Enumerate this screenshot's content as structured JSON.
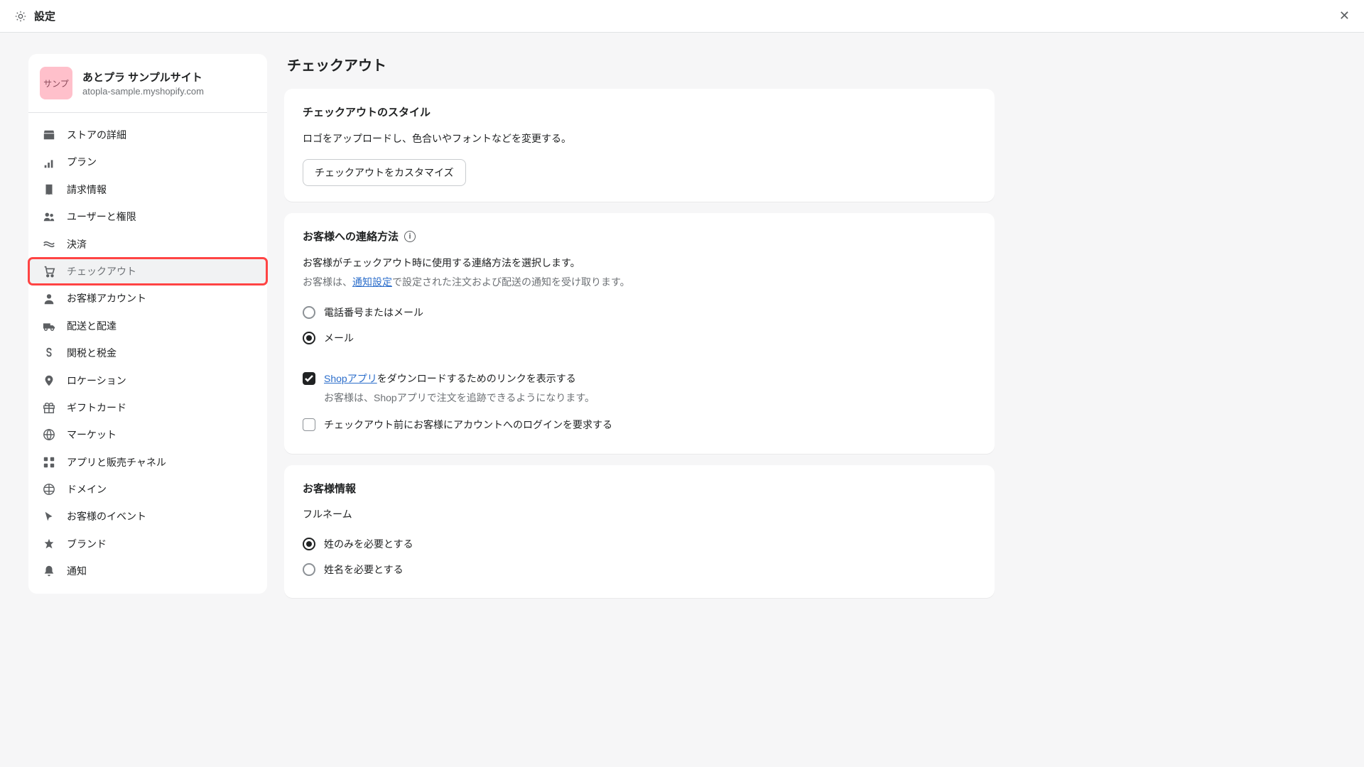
{
  "topbar": {
    "title": "設定"
  },
  "store": {
    "avatar_text": "サンプ",
    "name": "あとプラ サンプルサイト",
    "url": "atopla-sample.myshopify.com"
  },
  "sidebar": {
    "items": [
      {
        "label": "ストアの詳細",
        "icon": "store-icon"
      },
      {
        "label": "プラン",
        "icon": "plan-icon"
      },
      {
        "label": "請求情報",
        "icon": "bill-icon"
      },
      {
        "label": "ユーザーと権限",
        "icon": "users-icon"
      },
      {
        "label": "決済",
        "icon": "payment-icon"
      },
      {
        "label": "チェックアウト",
        "icon": "cart-icon"
      },
      {
        "label": "お客様アカウント",
        "icon": "person-icon"
      },
      {
        "label": "配送と配達",
        "icon": "truck-icon"
      },
      {
        "label": "関税と税金",
        "icon": "tax-icon"
      },
      {
        "label": "ロケーション",
        "icon": "pin-icon"
      },
      {
        "label": "ギフトカード",
        "icon": "gift-icon"
      },
      {
        "label": "マーケット",
        "icon": "globe-icon"
      },
      {
        "label": "アプリと販売チャネル",
        "icon": "apps-icon"
      },
      {
        "label": "ドメイン",
        "icon": "domain-icon"
      },
      {
        "label": "お客様のイベント",
        "icon": "cursor-icon"
      },
      {
        "label": "ブランド",
        "icon": "brand-icon"
      },
      {
        "label": "通知",
        "icon": "bell-icon"
      }
    ],
    "active_index": 5
  },
  "main": {
    "title": "チェックアウト",
    "style_card": {
      "title": "チェックアウトのスタイル",
      "desc": "ロゴをアップロードし、色合いやフォントなどを変更する。",
      "button": "チェックアウトをカスタマイズ"
    },
    "contact_card": {
      "title": "お客様への連絡方法",
      "desc1": "お客様がチェックアウト時に使用する連絡方法を選択します。",
      "desc2_a": "お客様は、",
      "desc2_link": "通知設定",
      "desc2_b": "で設定された注文および配送の通知を受け取ります。",
      "radio_options": [
        {
          "label": "電話番号またはメール",
          "checked": false
        },
        {
          "label": "メール",
          "checked": true
        }
      ],
      "checkbox1": {
        "checked": true,
        "link_text": "Shopアプリ",
        "label_rest": "をダウンロードするためのリンクを表示する",
        "sub": "お客様は、Shopアプリで注文を追跡できるようになります。"
      },
      "checkbox2": {
        "checked": false,
        "label": "チェックアウト前にお客様にアカウントへのログインを要求する"
      }
    },
    "customer_card": {
      "title": "お客様情報",
      "fullname_label": "フルネーム",
      "fullname_options": [
        {
          "label": "姓のみを必要とする",
          "checked": true
        },
        {
          "label": "姓名を必要とする",
          "checked": false
        }
      ]
    }
  }
}
